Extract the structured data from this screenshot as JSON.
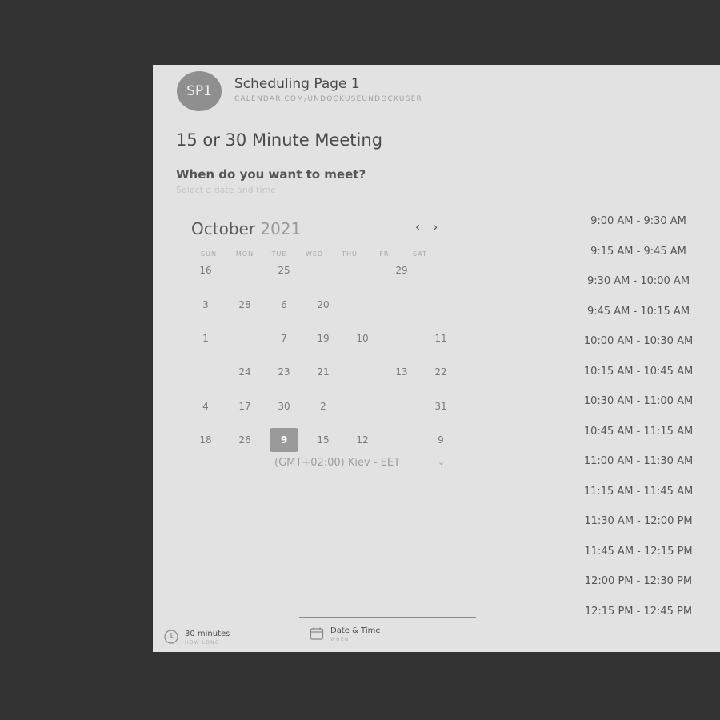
{
  "header": {
    "avatar_text": "SP1",
    "title": "Scheduling Page 1",
    "url": "CALENDAR.COM/UNDOCKUSEUNDOCKUSER"
  },
  "meeting": {
    "title": "15 or 30 Minute Meeting",
    "question": "When do you want to meet?",
    "hint": "Select a date and time"
  },
  "calendar": {
    "month": "October",
    "year": "2021",
    "prev_icon": "‹",
    "next_icon": "›",
    "weekdays": [
      "SUN",
      "MON",
      "TUE",
      "WED",
      "THU",
      "FRI",
      "SAT"
    ],
    "days": [
      {
        "label": "16",
        "selected": false
      },
      {
        "label": "25",
        "selected": false
      },
      {
        "label": "29",
        "selected": false
      },
      {
        "label": "3",
        "selected": false
      },
      {
        "label": "28",
        "selected": false
      },
      {
        "label": "6",
        "selected": false
      },
      {
        "label": "20",
        "selected": false
      },
      {
        "label": "1",
        "selected": false
      },
      {
        "label": "7",
        "selected": false
      },
      {
        "label": "19",
        "selected": false
      },
      {
        "label": "10",
        "selected": false
      },
      {
        "label": "11",
        "selected": false
      },
      {
        "label": "24",
        "selected": false
      },
      {
        "label": "23",
        "selected": false
      },
      {
        "label": "21",
        "selected": false
      },
      {
        "label": "13",
        "selected": false
      },
      {
        "label": "22",
        "selected": false
      },
      {
        "label": "4",
        "selected": false
      },
      {
        "label": "17",
        "selected": false
      },
      {
        "label": "30",
        "selected": false
      },
      {
        "label": "2",
        "selected": false
      },
      {
        "label": "31",
        "selected": false
      },
      {
        "label": "18",
        "selected": false
      },
      {
        "label": "26",
        "selected": false
      },
      {
        "label": "9",
        "selected": true
      },
      {
        "label": "15",
        "selected": false
      },
      {
        "label": "12",
        "selected": false
      },
      {
        "label": "9",
        "selected": false
      }
    ]
  },
  "timezone": {
    "label": "(GMT+02:00) Kiev - EET",
    "chevron": "⌄"
  },
  "slots": [
    "9:00 AM - 9:30 AM",
    "9:15 AM - 9:45 AM",
    "9:30 AM - 10:00 AM",
    "9:45 AM - 10:15 AM",
    "10:00 AM - 10:30 AM",
    "10:15 AM - 10:45 AM",
    "10:30 AM - 11:00 AM",
    "10:45 AM - 11:15 AM",
    "11:00 AM - 11:30 AM",
    "11:15 AM - 11:45 AM",
    "11:30 AM - 12:00 PM",
    "11:45 AM - 12:15 PM",
    "12:00 PM - 12:30 PM",
    "12:15 PM - 12:45 PM"
  ],
  "steps": {
    "duration_label": "30 minutes",
    "duration_sub": "HOW LONG",
    "when_label": "Date & Time",
    "when_sub": "WHEN"
  },
  "colors": {
    "background": "#333333",
    "panel": "#e2e2e2",
    "selected_day": "#9a9a9a"
  }
}
